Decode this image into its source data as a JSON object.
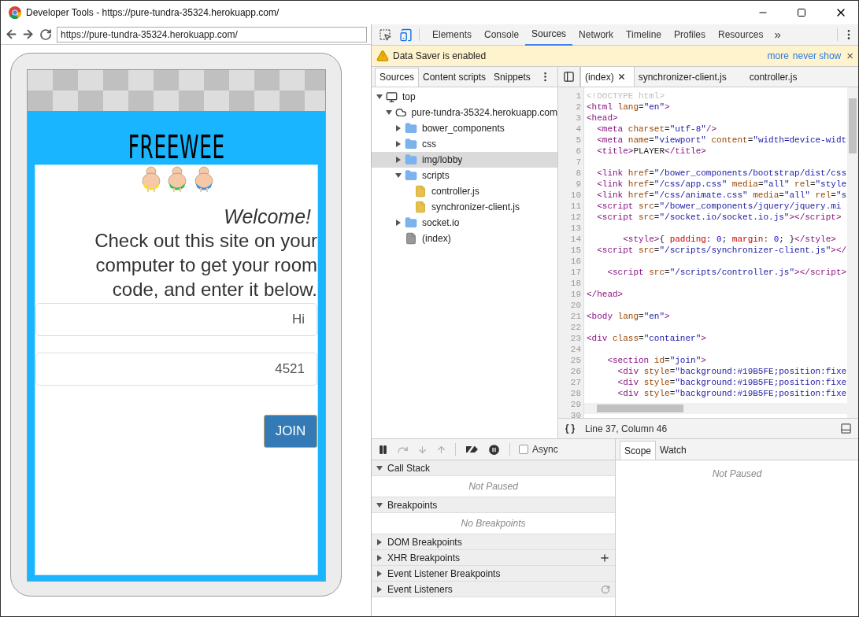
{
  "window": {
    "title": "Developer Tools - https://pure-tundra-35324.herokuapp.com/"
  },
  "browser": {
    "url": "https://pure-tundra-35324.herokuapp.com/"
  },
  "page": {
    "logo": "FREEWEE",
    "welcome": "Welcome!",
    "instructions": "Check out this site on your computer to get your room code, and enter it below.",
    "fields": [
      {
        "value": "Hi"
      },
      {
        "value": "4521"
      }
    ],
    "button": "JOIN"
  },
  "devtools": {
    "device_mode": {
      "on": true
    },
    "tabs": [
      {
        "label": "Elements",
        "selected": false
      },
      {
        "label": "Console",
        "selected": false
      },
      {
        "label": "Sources",
        "selected": true
      },
      {
        "label": "Network",
        "selected": false
      },
      {
        "label": "Timeline",
        "selected": false
      },
      {
        "label": "Profiles",
        "selected": false
      },
      {
        "label": "Resources",
        "selected": false
      }
    ],
    "more": "»",
    "infobar": {
      "message": "Data Saver is enabled",
      "links": [
        "more",
        "never show"
      ],
      "close": "×"
    },
    "navigator": {
      "tabs": [
        {
          "label": "Sources",
          "selected": true
        },
        {
          "label": "Content scripts",
          "selected": false
        },
        {
          "label": "Snippets",
          "selected": false
        }
      ],
      "tree": [
        {
          "kind": "frame",
          "label": "top",
          "expanded": true,
          "selected": false,
          "children": [
            {
              "kind": "domain",
              "label": "pure-tundra-35324.herokuapp.com",
              "expanded": true,
              "selected": false,
              "children": [
                {
                  "kind": "folder",
                  "label": "bower_components",
                  "expanded": false,
                  "selected": false
                },
                {
                  "kind": "folder",
                  "label": "css",
                  "expanded": false,
                  "selected": false
                },
                {
                  "kind": "folder",
                  "label": "img/lobby",
                  "expanded": false,
                  "selected": true
                },
                {
                  "kind": "folder",
                  "label": "scripts",
                  "expanded": true,
                  "selected": false,
                  "children": [
                    {
                      "kind": "script",
                      "label": "controller.js",
                      "selected": false
                    },
                    {
                      "kind": "script",
                      "label": "synchronizer-client.js",
                      "selected": false
                    }
                  ]
                },
                {
                  "kind": "folder",
                  "label": "socket.io",
                  "expanded": false,
                  "selected": false
                },
                {
                  "kind": "document",
                  "label": "(index)",
                  "selected": false
                }
              ]
            }
          ]
        }
      ]
    },
    "editor": {
      "tabs": [
        {
          "label": "(index)",
          "selected": true,
          "closable": true
        },
        {
          "label": "synchronizer-client.js",
          "selected": false,
          "closable": false
        },
        {
          "label": "controller.js",
          "selected": false,
          "closable": false
        }
      ],
      "lines": [
        {
          "number": "1",
          "tokens": [
            {
              "kind": "doc",
              "text": "<!DOCTYPE html>"
            }
          ]
        },
        {
          "number": "2",
          "tokens": [
            {
              "kind": "tag",
              "text": "<html "
            },
            {
              "kind": "attr",
              "text": "lang"
            },
            {
              "kind": "txt",
              "text": "="
            },
            {
              "kind": "val",
              "text": "\"en\""
            },
            {
              "kind": "tag",
              "text": ">"
            }
          ]
        },
        {
          "number": "3",
          "tokens": [
            {
              "kind": "tag",
              "text": "<head>"
            }
          ]
        },
        {
          "number": "4",
          "tokens": [
            {
              "kind": "tag",
              "text": "  <meta "
            },
            {
              "kind": "attr",
              "text": "charset"
            },
            {
              "kind": "txt",
              "text": "="
            },
            {
              "kind": "val",
              "text": "\"utf-8\""
            },
            {
              "kind": "tag",
              "text": "/>"
            }
          ]
        },
        {
          "number": "5",
          "tokens": [
            {
              "kind": "tag",
              "text": "  <meta "
            },
            {
              "kind": "attr",
              "text": "name"
            },
            {
              "kind": "txt",
              "text": "="
            },
            {
              "kind": "val",
              "text": "\"viewport\" "
            },
            {
              "kind": "attr",
              "text": "content"
            },
            {
              "kind": "txt",
              "text": "="
            },
            {
              "kind": "val",
              "text": "\"width=device-widt"
            }
          ]
        },
        {
          "number": "6",
          "tokens": [
            {
              "kind": "tag",
              "text": "  <title>"
            },
            {
              "kind": "txt",
              "text": "PLAYER"
            },
            {
              "kind": "tag",
              "text": "</title>"
            }
          ]
        },
        {
          "number": "7"
        },
        {
          "number": "8",
          "tokens": [
            {
              "kind": "tag",
              "text": "  <link "
            },
            {
              "kind": "attr",
              "text": "href"
            },
            {
              "kind": "txt",
              "text": "="
            },
            {
              "kind": "val",
              "text": "\"/bower_components/bootstrap/dist/css"
            }
          ]
        },
        {
          "number": "9",
          "tokens": [
            {
              "kind": "tag",
              "text": "  <link "
            },
            {
              "kind": "attr",
              "text": "href"
            },
            {
              "kind": "txt",
              "text": "="
            },
            {
              "kind": "val",
              "text": "\"/css/app.css\" "
            },
            {
              "kind": "attr",
              "text": "media"
            },
            {
              "kind": "txt",
              "text": "="
            },
            {
              "kind": "val",
              "text": "\"all\" "
            },
            {
              "kind": "attr",
              "text": "rel"
            },
            {
              "kind": "txt",
              "text": "="
            },
            {
              "kind": "val",
              "text": "\"style"
            }
          ]
        },
        {
          "number": "10",
          "tokens": [
            {
              "kind": "tag",
              "text": "  <link "
            },
            {
              "kind": "attr",
              "text": "href"
            },
            {
              "kind": "txt",
              "text": "="
            },
            {
              "kind": "val",
              "text": "\"/css/animate.css\" "
            },
            {
              "kind": "attr",
              "text": "media"
            },
            {
              "kind": "txt",
              "text": "="
            },
            {
              "kind": "val",
              "text": "\"all\" "
            },
            {
              "kind": "attr",
              "text": "rel"
            },
            {
              "kind": "txt",
              "text": "="
            },
            {
              "kind": "val",
              "text": "\"s"
            }
          ]
        },
        {
          "number": "11",
          "tokens": [
            {
              "kind": "tag",
              "text": "  <script "
            },
            {
              "kind": "attr",
              "text": "src"
            },
            {
              "kind": "txt",
              "text": "="
            },
            {
              "kind": "val",
              "text": "\"/bower_components/jquery/jquery.mi"
            }
          ]
        },
        {
          "number": "12",
          "tokens": [
            {
              "kind": "tag",
              "text": "  <script "
            },
            {
              "kind": "attr",
              "text": "src"
            },
            {
              "kind": "txt",
              "text": "="
            },
            {
              "kind": "val",
              "text": "\"/socket.io/socket.io.js\""
            },
            {
              "kind": "tag",
              "text": "></script>"
            }
          ]
        },
        {
          "number": "13"
        },
        {
          "number": "14",
          "tokens": [
            {
              "kind": "tag",
              "text": "       <style>"
            },
            {
              "kind": "txt",
              "text": "{ "
            },
            {
              "kind": "prop",
              "text": "padding"
            },
            {
              "kind": "txt",
              "text": ": "
            },
            {
              "kind": "num",
              "text": "0"
            },
            {
              "kind": "txt",
              "text": "; "
            },
            {
              "kind": "prop",
              "text": "margin"
            },
            {
              "kind": "txt",
              "text": ": "
            },
            {
              "kind": "num",
              "text": "0"
            },
            {
              "kind": "txt",
              "text": "; }"
            },
            {
              "kind": "tag",
              "text": "</style>"
            }
          ]
        },
        {
          "number": "15",
          "tokens": [
            {
              "kind": "tag",
              "text": "  <script "
            },
            {
              "kind": "attr",
              "text": "src"
            },
            {
              "kind": "txt",
              "text": "="
            },
            {
              "kind": "val",
              "text": "\"/scripts/synchronizer-client.js\""
            },
            {
              "kind": "tag",
              "text": "></"
            }
          ]
        },
        {
          "number": "16"
        },
        {
          "number": "17",
          "tokens": [
            {
              "kind": "tag",
              "text": "    <script "
            },
            {
              "kind": "attr",
              "text": "src"
            },
            {
              "kind": "txt",
              "text": "="
            },
            {
              "kind": "val",
              "text": "\"/scripts/controller.js\""
            },
            {
              "kind": "tag",
              "text": "></script>"
            }
          ]
        },
        {
          "number": "18"
        },
        {
          "number": "19",
          "tokens": [
            {
              "kind": "tag",
              "text": "</head>"
            }
          ]
        },
        {
          "number": "20"
        },
        {
          "number": "21",
          "tokens": [
            {
              "kind": "tag",
              "text": "<body "
            },
            {
              "kind": "attr",
              "text": "lang"
            },
            {
              "kind": "txt",
              "text": "="
            },
            {
              "kind": "val",
              "text": "\"en\""
            },
            {
              "kind": "tag",
              "text": ">"
            }
          ]
        },
        {
          "number": "22"
        },
        {
          "number": "23",
          "tokens": [
            {
              "kind": "tag",
              "text": "<div "
            },
            {
              "kind": "attr",
              "text": "class"
            },
            {
              "kind": "txt",
              "text": "="
            },
            {
              "kind": "val",
              "text": "\"container\""
            },
            {
              "kind": "tag",
              "text": ">"
            }
          ]
        },
        {
          "number": "24"
        },
        {
          "number": "25",
          "tokens": [
            {
              "kind": "tag",
              "text": "    <section "
            },
            {
              "kind": "attr",
              "text": "id"
            },
            {
              "kind": "txt",
              "text": "="
            },
            {
              "kind": "val",
              "text": "\"join\""
            },
            {
              "kind": "tag",
              "text": ">"
            }
          ]
        },
        {
          "number": "26",
          "tokens": [
            {
              "kind": "tag",
              "text": "      <div "
            },
            {
              "kind": "attr",
              "text": "style"
            },
            {
              "kind": "txt",
              "text": "="
            },
            {
              "kind": "val",
              "text": "\"background:#19B5FE;position:fixe"
            }
          ]
        },
        {
          "number": "27",
          "tokens": [
            {
              "kind": "tag",
              "text": "      <div "
            },
            {
              "kind": "attr",
              "text": "style"
            },
            {
              "kind": "txt",
              "text": "="
            },
            {
              "kind": "val",
              "text": "\"background:#19B5FE;position:fixe"
            }
          ]
        },
        {
          "number": "28",
          "tokens": [
            {
              "kind": "tag",
              "text": "      <div "
            },
            {
              "kind": "attr",
              "text": "style"
            },
            {
              "kind": "txt",
              "text": "="
            },
            {
              "kind": "val",
              "text": "\"background:#19B5FE;position:fixe"
            }
          ]
        },
        {
          "number": "29"
        },
        {
          "number": "30"
        }
      ],
      "status": "Line 37, Column 46"
    },
    "debugger": {
      "async": {
        "label": "Async",
        "checked": false
      },
      "sections": [
        {
          "title": "Call Stack",
          "expanded": true,
          "message": "Not Paused"
        },
        {
          "title": "Breakpoints",
          "expanded": true,
          "message": "No Breakpoints"
        },
        {
          "title": "DOM Breakpoints",
          "expanded": false
        },
        {
          "title": "XHR Breakpoints",
          "expanded": false,
          "add_button": true
        },
        {
          "title": "Event Listener Breakpoints",
          "expanded": false
        },
        {
          "title": "Event Listeners",
          "expanded": false,
          "refresh_button": true
        }
      ]
    },
    "sidebar": {
      "tabs": [
        {
          "label": "Scope",
          "selected": true
        },
        {
          "label": "Watch",
          "selected": false
        }
      ],
      "message": "Not Paused"
    }
  }
}
